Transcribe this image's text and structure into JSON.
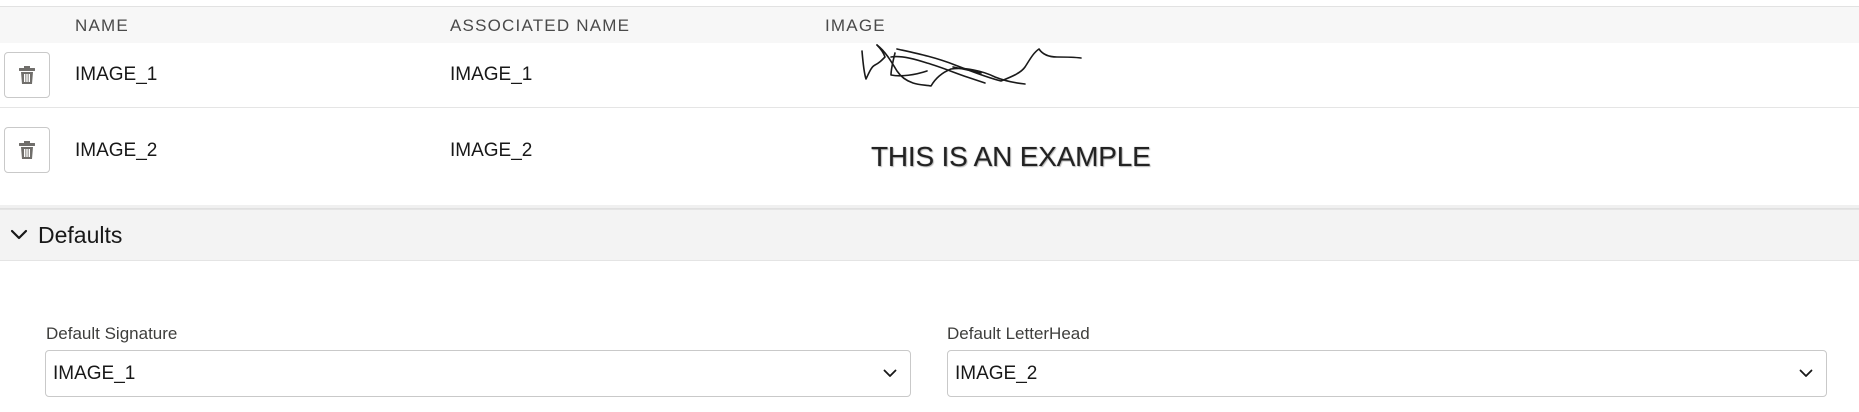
{
  "table": {
    "columns": {
      "name": "NAME",
      "associated_name": "ASSOCIATED NAME",
      "image": "IMAGE"
    },
    "rows": [
      {
        "name": "IMAGE_1",
        "associated_name": "IMAGE_1",
        "image_kind": "handwritten signature scribble"
      },
      {
        "name": "IMAGE_2",
        "associated_name": "IMAGE_2",
        "image_text": "THIS IS AN EXAMPLE"
      }
    ],
    "row_action_icon": "trash-icon"
  },
  "defaults": {
    "section_title": "Defaults",
    "section_icon": "chevron-down-icon",
    "signature": {
      "label": "Default Signature",
      "value": "IMAGE_1"
    },
    "letterhead": {
      "label": "Default LetterHead",
      "value": "IMAGE_2"
    }
  },
  "colors": {
    "header_bg": "#f7f7f7",
    "section_bg": "#f3f3f3",
    "border": "#c9c9c9",
    "text": "#181818",
    "icon": "#706e6b"
  }
}
